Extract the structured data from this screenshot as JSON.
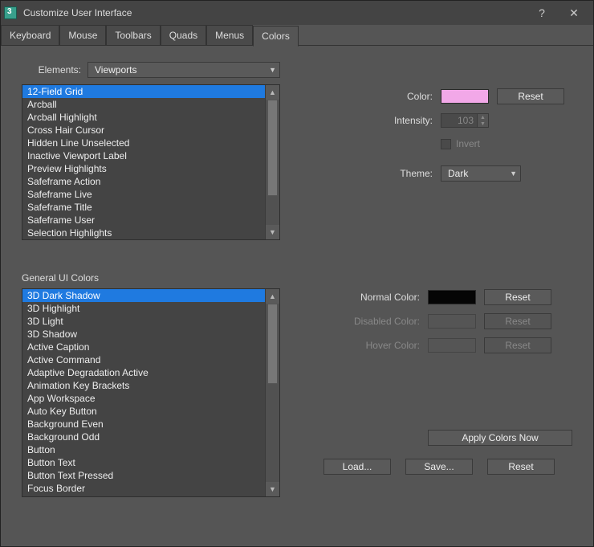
{
  "window": {
    "title": "Customize User Interface",
    "help": "?",
    "close": "✕"
  },
  "tabs": [
    "Keyboard",
    "Mouse",
    "Toolbars",
    "Quads",
    "Menus",
    "Colors"
  ],
  "active_tab": 5,
  "elements": {
    "label": "Elements:",
    "dropdown_value": "Viewports",
    "list": [
      "12-Field Grid",
      "Arcball",
      "Arcball Highlight",
      "Cross Hair Cursor",
      "Hidden Line Unselected",
      "Inactive Viewport Label",
      "Preview Highlights",
      "Safeframe Action",
      "Safeframe Live",
      "Safeframe Title",
      "Safeframe User",
      "Selection Highlights"
    ],
    "selected_index": 0
  },
  "color_panel": {
    "color_label": "Color:",
    "color_value": "#f2a8e8",
    "reset": "Reset",
    "intensity_label": "Intensity:",
    "intensity_value": "103",
    "invert_label": "Invert",
    "invert_checked": false,
    "theme_label": "Theme:",
    "theme_value": "Dark"
  },
  "general": {
    "section_label": "General UI Colors",
    "list": [
      "3D Dark Shadow",
      "3D Highlight",
      "3D Light",
      "3D Shadow",
      "Active Caption",
      "Active Command",
      "Adaptive Degradation Active",
      "Animation Key Brackets",
      "App Workspace",
      "Auto Key Button",
      "Background Even",
      "Background Odd",
      "Button",
      "Button Text",
      "Button Text Pressed",
      "Focus Border"
    ],
    "selected_index": 0,
    "normal_label": "Normal Color:",
    "normal_value": "#050505",
    "disabled_label": "Disabled Color:",
    "hover_label": "Hover Color:",
    "reset": "Reset",
    "apply": "Apply Colors Now",
    "load": "Load...",
    "save": "Save...",
    "reset_bottom": "Reset"
  }
}
